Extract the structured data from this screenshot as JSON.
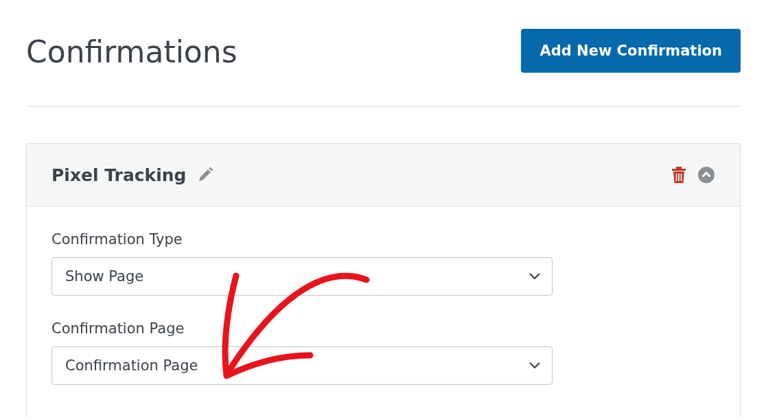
{
  "page_title": "Confirmations",
  "add_button": "Add New Confirmation",
  "panel": {
    "title": "Pixel Tracking",
    "expanded": true,
    "fields": [
      {
        "label": "Confirmation Type",
        "value": "Show Page"
      },
      {
        "label": "Confirmation Page",
        "value": "Confirmation Page"
      }
    ]
  }
}
